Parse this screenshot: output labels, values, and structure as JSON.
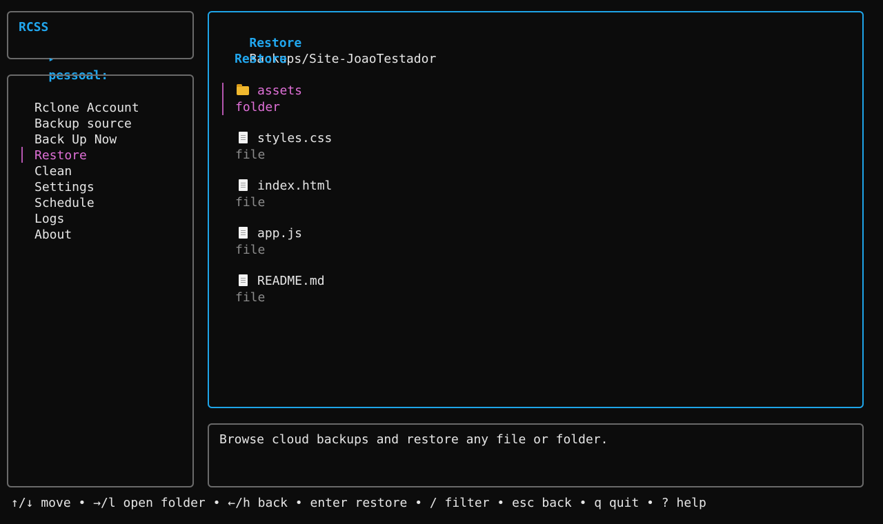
{
  "header": {
    "app_name": "RCSS",
    "profile_marker": "▸",
    "profile": "pessoal:"
  },
  "menu": {
    "items": [
      {
        "label": "Rclone Account",
        "selected": false
      },
      {
        "label": "Backup source",
        "selected": false
      },
      {
        "label": "Back Up Now",
        "selected": false
      },
      {
        "label": "Restore",
        "selected": true
      },
      {
        "label": "Clean",
        "selected": false
      },
      {
        "label": "Settings",
        "selected": false
      },
      {
        "label": "Schedule",
        "selected": false
      },
      {
        "label": "Logs",
        "selected": false
      },
      {
        "label": "About",
        "selected": false
      }
    ]
  },
  "main": {
    "title_label": "Restore",
    "path": "Backups/Site-JoaoTestador",
    "section_title": "Restore",
    "entries": [
      {
        "icon": "folder-icon",
        "name": "assets",
        "type": "folder",
        "selected": true
      },
      {
        "icon": "file-icon",
        "name": "styles.css",
        "type": "file",
        "selected": false
      },
      {
        "icon": "file-icon",
        "name": "index.html",
        "type": "file",
        "selected": false
      },
      {
        "icon": "file-icon",
        "name": "app.js",
        "type": "file",
        "selected": false
      },
      {
        "icon": "file-icon",
        "name": "README.md",
        "type": "file",
        "selected": false
      }
    ]
  },
  "description": "Browse cloud backups and restore any file or folder.",
  "footer": "↑/↓ move • →/l open folder • ←/h back • enter restore • / filter • esc back • q quit • ? help",
  "colors": {
    "accent": "#21a7ef",
    "selected": "#e070d8",
    "border": "#6a6a6a",
    "background": "#0c0c0c"
  }
}
